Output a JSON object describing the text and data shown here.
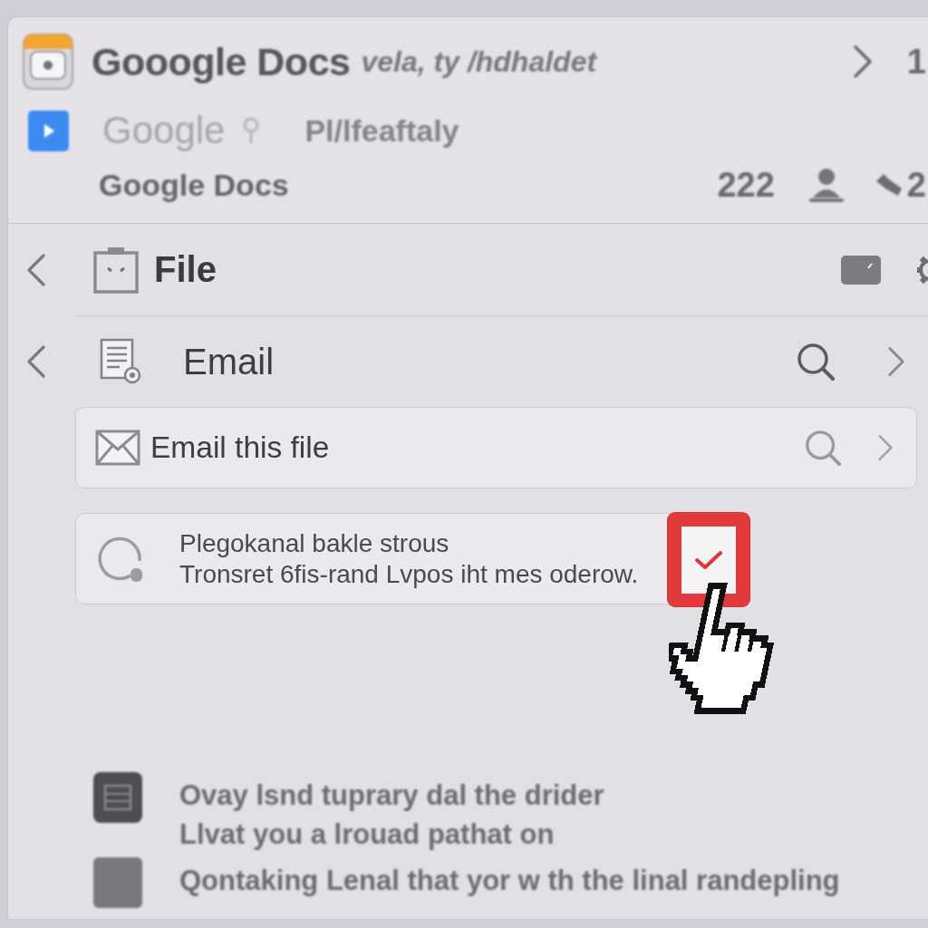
{
  "header": {
    "app_title": "Gooogle Docs",
    "app_subtitle": "vela, ty /hdhaldet",
    "forward_label": "1",
    "account_name": "Google",
    "account_detail": "Pl/lfeaftaly",
    "document_title": "Google Docs",
    "viewer_count": "222",
    "edit_count": "2"
  },
  "menu": {
    "title": "File",
    "item": "Email"
  },
  "options": [
    {
      "kind": "action",
      "label": "Email this file"
    },
    {
      "kind": "toggle",
      "lines": [
        "Plegokanal bakle strous",
        "Tronsret 6fis-rand Lvpos iht mes oderow."
      ],
      "checked": true
    }
  ],
  "suggestions": [
    {
      "kind": "grid",
      "lines": [
        "Ovay lsnd tuprary dal the drider",
        "Llvat you a lrouad pathat on"
      ]
    },
    {
      "kind": "plain",
      "lines": [
        "Qontaking Lenal that yor w th the linal randepling"
      ]
    }
  ]
}
